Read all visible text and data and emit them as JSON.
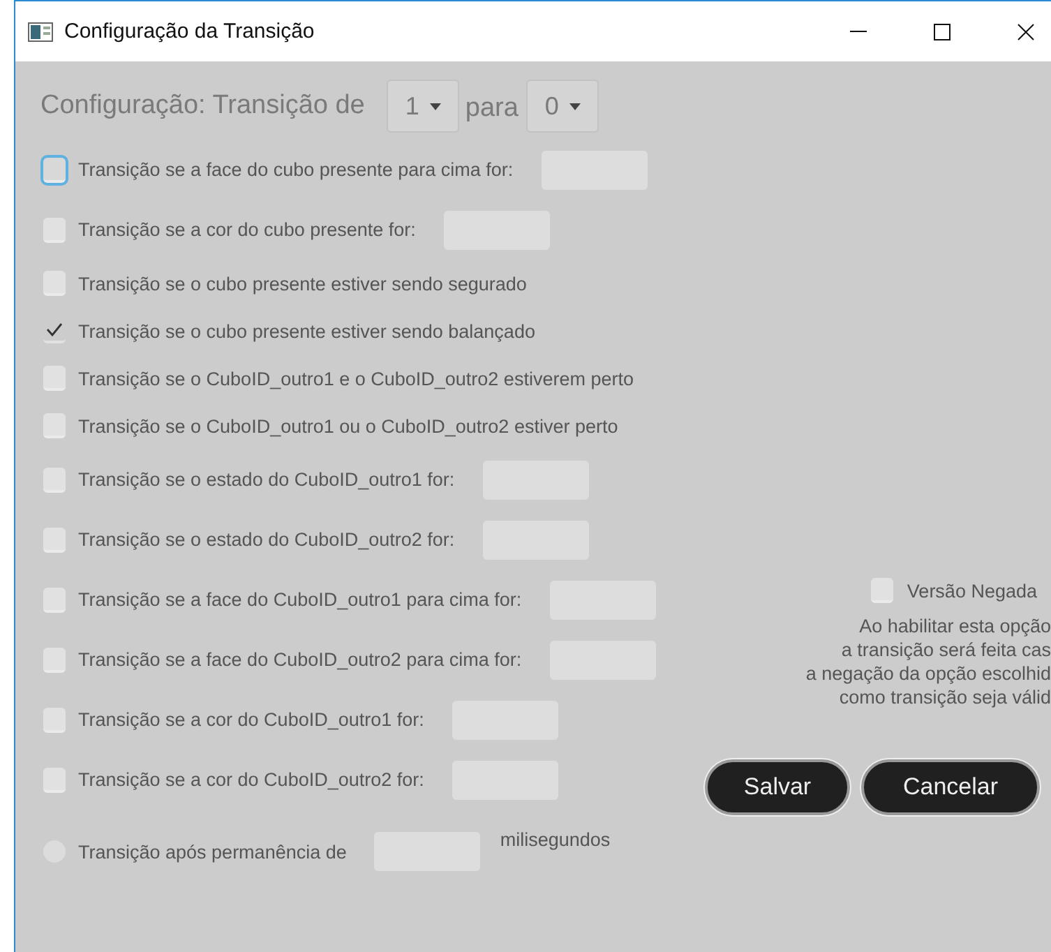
{
  "window": {
    "title": "Configuração da Transição"
  },
  "header": {
    "label": "Configuração: Transição de",
    "from": {
      "value": "1"
    },
    "connector": "para",
    "to": {
      "value": "0"
    }
  },
  "options": [
    {
      "kind": "checkbox",
      "label": "Transição se a face do cubo presente para cima for:",
      "checked": false,
      "focused": true,
      "has_field": true
    },
    {
      "kind": "checkbox",
      "label": "Transição se a cor do cubo presente for:",
      "checked": false,
      "focused": false,
      "has_field": true
    },
    {
      "kind": "checkbox",
      "label": "Transição se o cubo presente estiver sendo segurado",
      "checked": false,
      "focused": false,
      "has_field": false
    },
    {
      "kind": "checkbox",
      "label": "Transição se o cubo presente estiver sendo balançado",
      "checked": true,
      "focused": false,
      "has_field": false
    },
    {
      "kind": "checkbox",
      "label": "Transição se o CuboID_outro1 e o CuboID_outro2 estiverem perto",
      "checked": false,
      "focused": false,
      "has_field": false
    },
    {
      "kind": "checkbox",
      "label": "Transição se o CuboID_outro1 ou o CuboID_outro2 estiver perto",
      "checked": false,
      "focused": false,
      "has_field": false
    },
    {
      "kind": "checkbox",
      "label": "Transição se o estado do CuboID_outro1 for:",
      "checked": false,
      "focused": false,
      "has_field": true
    },
    {
      "kind": "checkbox",
      "label": "Transição se o estado do CuboID_outro2 for:",
      "checked": false,
      "focused": false,
      "has_field": true
    },
    {
      "kind": "checkbox",
      "label": "Transição se a face do CuboID_outro1 para cima for:",
      "checked": false,
      "focused": false,
      "has_field": true
    },
    {
      "kind": "checkbox",
      "label": "Transição se a face do CuboID_outro2 para cima for:",
      "checked": false,
      "focused": false,
      "has_field": true
    },
    {
      "kind": "checkbox",
      "label": "Transição se a cor do CuboID_outro1 for:",
      "checked": false,
      "focused": false,
      "has_field": true
    },
    {
      "kind": "checkbox",
      "label": "Transição se a cor do CuboID_outro2 for:",
      "checked": false,
      "focused": false,
      "has_field": true
    },
    {
      "kind": "radio",
      "label": "Transição após permanência de",
      "checked": false,
      "focused": false,
      "has_field": true,
      "suffix": "milisegundos"
    }
  ],
  "negated": {
    "label": "Versão Negada",
    "checked": false,
    "description": [
      "Ao habilitar esta opção",
      "a transição será feita cas",
      "a negação da opção escolhid",
      "como transição seja válid"
    ]
  },
  "buttons": [
    "Salvar",
    "Cancelar"
  ]
}
